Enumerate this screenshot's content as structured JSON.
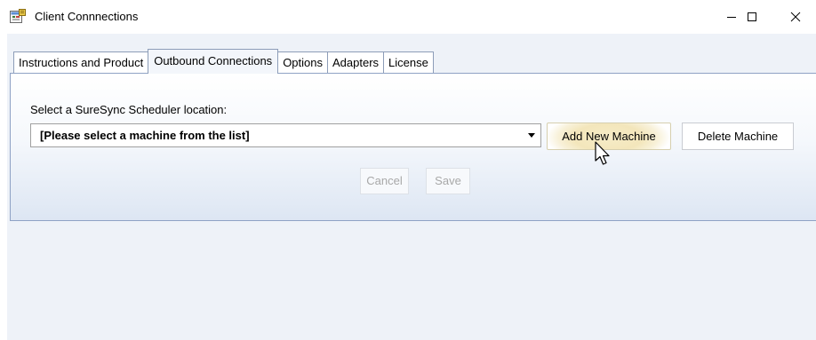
{
  "window": {
    "title": "Client Connnections",
    "icon": "app-icon",
    "controls": {
      "minimize": "minimize-icon",
      "maximize": "maximize-icon",
      "close": "close-icon"
    }
  },
  "tabs": [
    {
      "label": "Instructions and Product",
      "active": false
    },
    {
      "label": "Outbound Connections",
      "active": true
    },
    {
      "label": "Options",
      "active": false
    },
    {
      "label": "Adapters",
      "active": false
    },
    {
      "label": "License",
      "active": false
    }
  ],
  "panel": {
    "location_label": "Select a SureSync Scheduler location:",
    "machine_select": {
      "value": "[Please select a machine from the list]"
    },
    "add_button": "Add New Machine",
    "delete_button": "Delete Machine",
    "cancel_button": "Cancel",
    "save_button": "Save"
  },
  "colors": {
    "panel_border": "#8fa2c5",
    "panel_bottom": "#dde6f3",
    "add_highlight": "#f3e6bb",
    "disabled_text": "#a8a8a8"
  }
}
